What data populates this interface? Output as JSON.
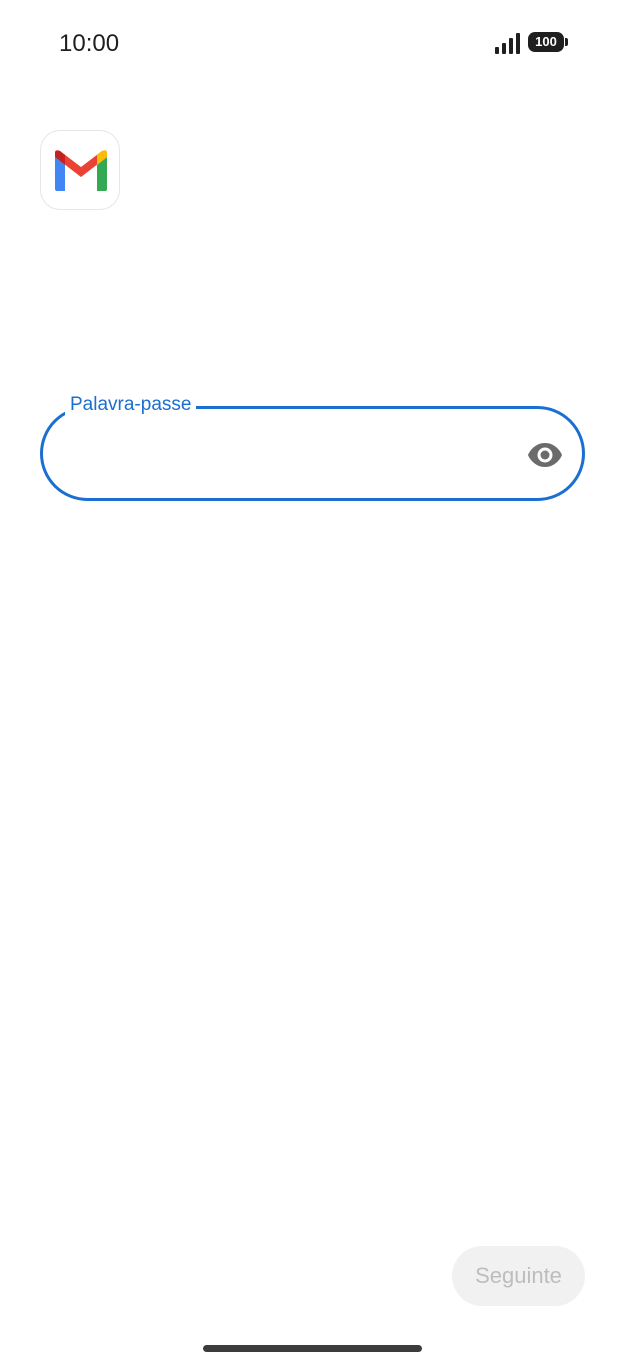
{
  "status_bar": {
    "time": "10:00",
    "battery_level": "100",
    "signal_icon": "signal-bars-icon",
    "battery_icon": "battery-icon"
  },
  "app": {
    "logo_icon": "gmail-logo-icon"
  },
  "password_field": {
    "label": "Palavra-passe",
    "value": "",
    "visibility_icon": "eye-icon",
    "accent_color": "#1a6fd1"
  },
  "next_button": {
    "label": "Seguinte",
    "disabled": true
  }
}
